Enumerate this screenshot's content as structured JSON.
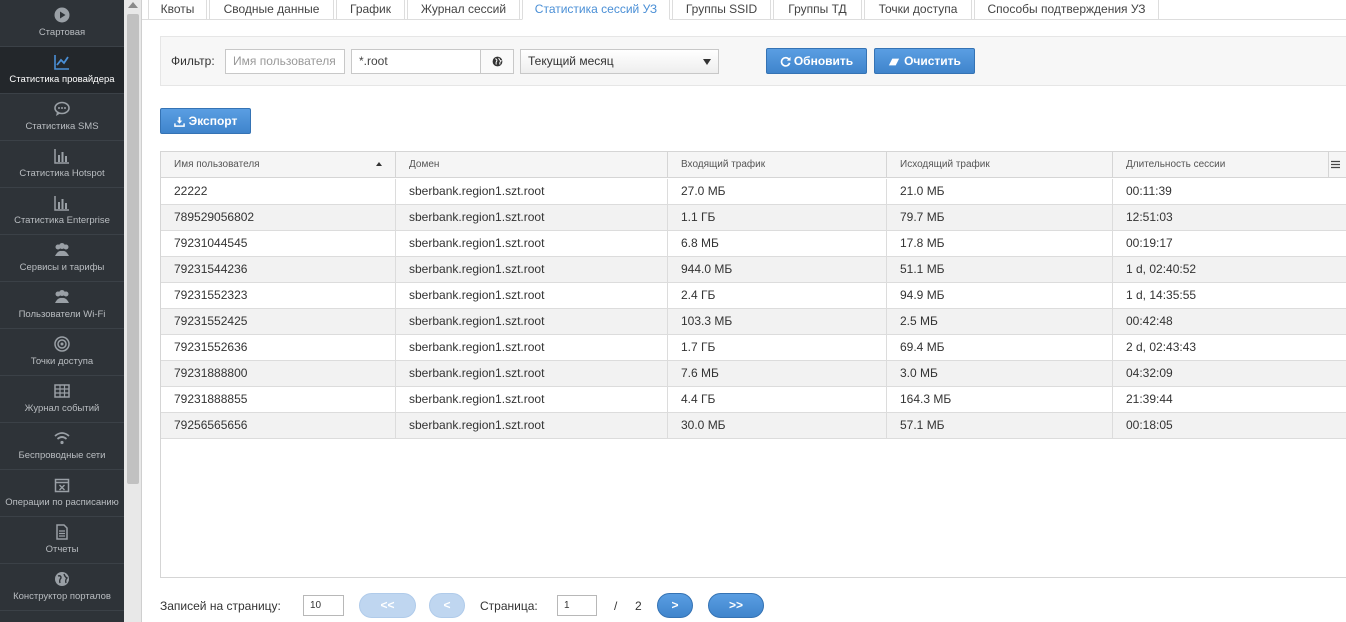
{
  "sidebar": {
    "items": [
      {
        "label": "Стартовая",
        "icon": "play-circle-icon",
        "active": false
      },
      {
        "label": "Статистика провайдера",
        "icon": "line-chart-icon",
        "active": true
      },
      {
        "label": "Статистика SMS",
        "icon": "chat-bubble-icon",
        "active": false
      },
      {
        "label": "Статистика Hotspot",
        "icon": "bar-chart-icon",
        "active": false
      },
      {
        "label": "Статистика Enterprise",
        "icon": "bar-chart-icon",
        "active": false
      },
      {
        "label": "Сервисы и тарифы",
        "icon": "users-icon",
        "active": false
      },
      {
        "label": "Пользователи Wi-Fi",
        "icon": "users-icon",
        "active": false
      },
      {
        "label": "Точки доступа",
        "icon": "target-icon",
        "active": false
      },
      {
        "label": "Журнал событий",
        "icon": "table-icon",
        "active": false
      },
      {
        "label": "Беспроводные сети",
        "icon": "wifi-icon",
        "active": false
      },
      {
        "label": "Операции по расписанию",
        "icon": "calendar-icon",
        "active": false
      },
      {
        "label": "Отчеты",
        "icon": "document-icon",
        "active": false
      },
      {
        "label": "Конструктор порталов",
        "icon": "globe-icon",
        "active": false
      }
    ]
  },
  "tabs": [
    {
      "label": "Квоты",
      "active": false
    },
    {
      "label": "Сводные данные",
      "active": false
    },
    {
      "label": "График",
      "active": false
    },
    {
      "label": "Журнал сессий",
      "active": false
    },
    {
      "label": "Статистика сессий УЗ",
      "active": true
    },
    {
      "label": "Группы SSID",
      "active": false
    },
    {
      "label": "Группы ТД",
      "active": false
    },
    {
      "label": "Точки доступа",
      "active": false
    },
    {
      "label": "Способы подтверждения УЗ",
      "active": false
    }
  ],
  "filter": {
    "label": "Фильтр:",
    "username_placeholder": "Имя пользователя",
    "domain_value": "*.root",
    "period_value": "Текущий месяц",
    "refresh_label": "Обновить",
    "clear_label": "Очистить"
  },
  "export_label": "Экспорт",
  "table": {
    "columns": [
      "Имя пользователя",
      "Домен",
      "Входящий трафик",
      "Исходящий трафик",
      "Длительность сессии"
    ],
    "rows": [
      [
        "22222",
        "sberbank.region1.szt.root",
        "27.0 МБ",
        "21.0 МБ",
        "00:11:39"
      ],
      [
        "789529056802",
        "sberbank.region1.szt.root",
        "1.1 ГБ",
        "79.7 МБ",
        "12:51:03"
      ],
      [
        "79231044545",
        "sberbank.region1.szt.root",
        "6.8 МБ",
        "17.8 МБ",
        "00:19:17"
      ],
      [
        "79231544236",
        "sberbank.region1.szt.root",
        "944.0 МБ",
        "51.1 МБ",
        "1 d, 02:40:52"
      ],
      [
        "79231552323",
        "sberbank.region1.szt.root",
        "2.4 ГБ",
        "94.9 МБ",
        "1 d, 14:35:55"
      ],
      [
        "79231552425",
        "sberbank.region1.szt.root",
        "103.3 МБ",
        "2.5 МБ",
        "00:42:48"
      ],
      [
        "79231552636",
        "sberbank.region1.szt.root",
        "1.7 ГБ",
        "69.4 МБ",
        "2 d, 02:43:43"
      ],
      [
        "79231888800",
        "sberbank.region1.szt.root",
        "7.6 МБ",
        "3.0 МБ",
        "04:32:09"
      ],
      [
        "79231888855",
        "sberbank.region1.szt.root",
        "4.4 ГБ",
        "164.3 МБ",
        "21:39:44"
      ],
      [
        "79256565656",
        "sberbank.region1.szt.root",
        "30.0 МБ",
        "57.1 МБ",
        "00:18:05"
      ]
    ]
  },
  "pager": {
    "per_page_label": "Записей на страницу:",
    "per_page_value": "10",
    "first_label": "<<",
    "prev_label": "<",
    "page_label": "Страница:",
    "page_value": "1",
    "separator": "/",
    "total_pages": "2",
    "next_label": ">",
    "last_label": ">>"
  },
  "colors": {
    "sidebar_bg": "#2e3338",
    "accent": "#4a8fd6",
    "button_blue": "#3f84cc"
  }
}
